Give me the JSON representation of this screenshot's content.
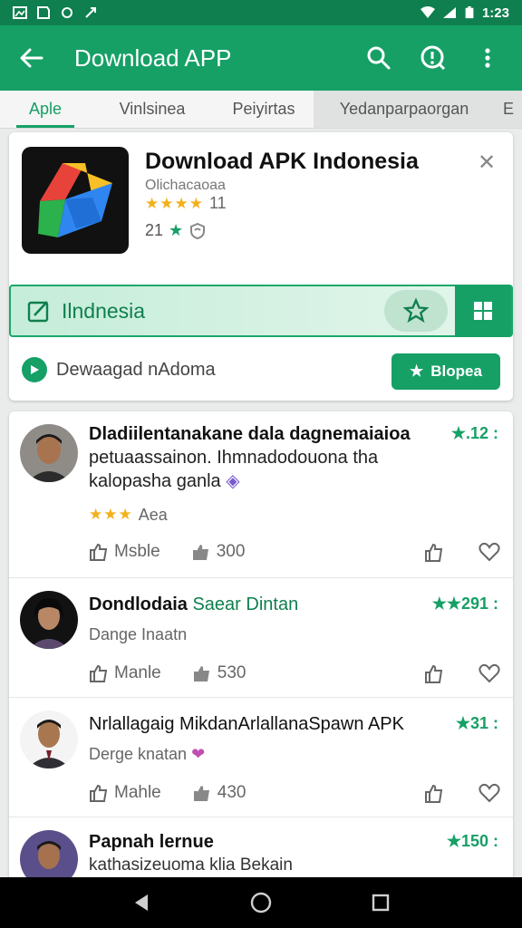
{
  "status_bar": {
    "time": "1:23"
  },
  "app_bar": {
    "title": "Download APP",
    "icons": [
      "back-arrow-icon",
      "search-icon",
      "help-icon",
      "more-vert-icon"
    ]
  },
  "tabs": [
    {
      "label": "Aple",
      "active": true
    },
    {
      "label": "Vinlsinea"
    },
    {
      "label": "Peiyirtas"
    },
    {
      "label": "Yedanparpaorgan"
    },
    {
      "label": "E"
    }
  ],
  "featured": {
    "title": "Download APK Indonesia",
    "subtitle": "Olichacaoaa",
    "rating_stars": "★★★★",
    "rating_count": "11",
    "meta_value": "21",
    "search_label": "Ilndnesia",
    "download_text": "Dewaagad nAdoma",
    "open_label": "Blopea"
  },
  "reviews": [
    {
      "name_bold": "Dladiilentanakane dala dagnemaiaioa",
      "name_rest": "",
      "line2": "petuaassainon. Ihmnadodouona tha",
      "line3": "kalopasha ganla",
      "score": "★.12 :",
      "stars": "★★★",
      "sub": "Aea",
      "like_label": "Msble",
      "thumb_count": "300"
    },
    {
      "name_bold": "Dondlodaia",
      "name_rest": "Saear Dintan",
      "sub": "Dange Inaatn",
      "score": "★★291 :",
      "like_label": "Manle",
      "thumb_count": "530"
    },
    {
      "name_bold": "Nrlallagaig MikdanArlallanaSpawn APK",
      "name_rest": "",
      "sub": "Derge knatan",
      "score": "★31 :",
      "like_label": "Mahle",
      "thumb_count": "430"
    },
    {
      "name_bold": "Papnah lernue",
      "name_rest": "",
      "sub": "kathasizeuoma klia Bekain",
      "score": "★150 :"
    }
  ],
  "colors": {
    "primary": "#16a066",
    "primary_dark": "#0f7f4f",
    "star": "#f3b01b"
  }
}
